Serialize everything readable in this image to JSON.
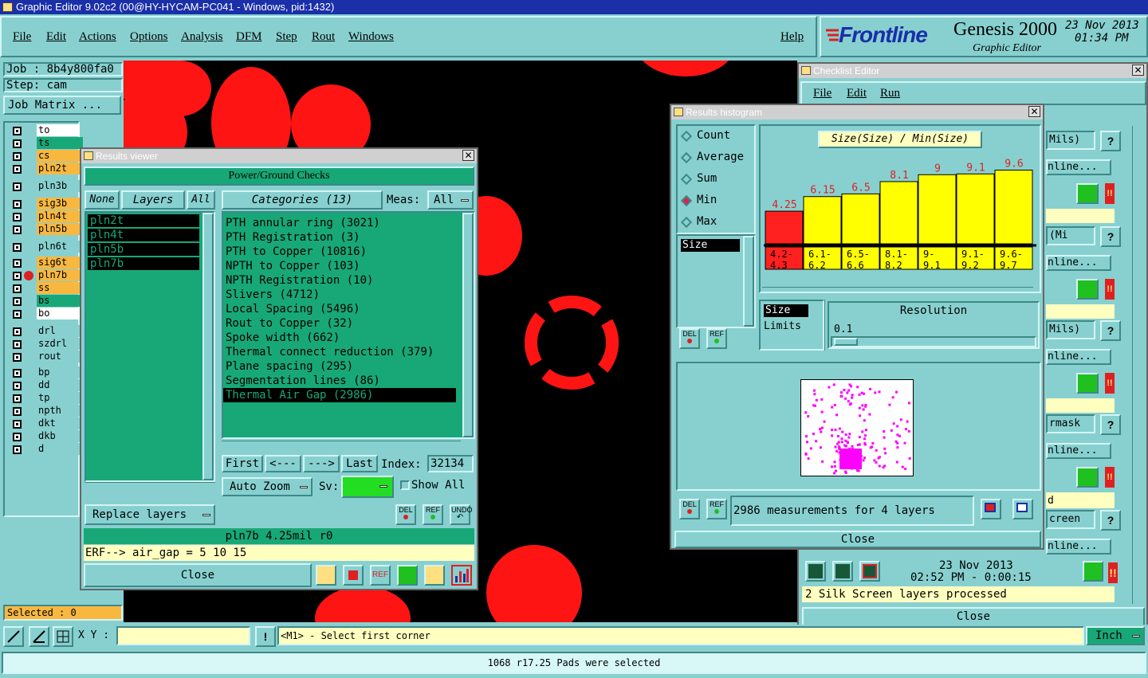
{
  "app": {
    "title": "Graphic Editor 9.02c2 (00@HY-HYCAM-PC041 - Windows, pid:1432)",
    "menu": [
      "File",
      "Edit",
      "Actions",
      "Options",
      "Analysis",
      "DFM",
      "Step",
      "Rout",
      "Windows"
    ],
    "help": "Help",
    "brand_logo": "Frontline",
    "brand_product": "Genesis 2000",
    "brand_sub": "Graphic Editor",
    "date": "23 Nov 2013",
    "time": "01:34 PM"
  },
  "left": {
    "job": "Job : 8b4y800fa0",
    "step": "Step: cam",
    "job_matrix": "Job Matrix ...",
    "layers": [
      {
        "name": "to",
        "color": "#ffffff"
      },
      {
        "name": "ts",
        "color": "#18a878"
      },
      {
        "name": "cs",
        "color": "#f8b840"
      },
      {
        "name": "pln2t",
        "color": "#f8b840"
      },
      {
        "name": "pln3b",
        "color": "#88d0d0"
      },
      {
        "name": "sig3b",
        "color": "#f8b840"
      },
      {
        "name": "pln4t",
        "color": "#f8b840"
      },
      {
        "name": "pln5b",
        "color": "#f8b840"
      },
      {
        "name": "pln6t",
        "color": "#88d0d0"
      },
      {
        "name": "sig6t",
        "color": "#f8b840"
      },
      {
        "name": "pln7b",
        "color": "#f8b840"
      },
      {
        "name": "ss",
        "color": "#f8b840"
      },
      {
        "name": "bs",
        "color": "#18a878"
      },
      {
        "name": "bo",
        "color": "#ffffff"
      },
      {
        "name": "drl",
        "color": "#88d0d0"
      },
      {
        "name": "szdrl",
        "color": "#88d0d0"
      },
      {
        "name": "rout",
        "color": "#88d0d0"
      },
      {
        "name": "bp",
        "color": "#88d0d0"
      },
      {
        "name": "dd",
        "color": "#88d0d0"
      },
      {
        "name": "tp",
        "color": "#88d0d0"
      },
      {
        "name": "npth",
        "color": "#88d0d0"
      },
      {
        "name": "dkt",
        "color": "#88d0d0"
      },
      {
        "name": "dkb",
        "color": "#88d0d0"
      },
      {
        "name": "d",
        "color": "#88d0d0"
      }
    ],
    "selected": "Selected : 0"
  },
  "results_viewer": {
    "title": "Results viewer",
    "header": "Power/Ground Checks",
    "none": "None",
    "layers_label": "Layers",
    "all": "All",
    "categories_label": "Categories (13)",
    "meas_label": "Meas:",
    "meas_value": "All",
    "layers": [
      "pln2t",
      "pln4t",
      "pln5b",
      "pln7b"
    ],
    "categories": [
      "PTH annular ring (3021)",
      "PTH Registration (3)",
      "PTH to Copper (10816)",
      "NPTH to Copper (103)",
      "NPTH Registration (10)",
      "Slivers (4712)",
      "Local Spacing (5496)",
      "Rout to Copper (32)",
      "Spoke width (662)",
      "Thermal connect reduction (379)",
      "Plane spacing (295)",
      "Segmentation lines (86)",
      "Thermal Air Gap (2986)"
    ],
    "first": "First",
    "prev": "<---",
    "next": "--->",
    "last": "Last",
    "index_label": "Index:",
    "index_value": "32134",
    "auto_zoom": "Auto Zoom",
    "sv_label": "Sv:",
    "show_all": "Show All",
    "replace_layers": "Replace layers",
    "del": "DEL",
    "ref": "REF",
    "undo": "UNDO",
    "status": "pln7b 4.25mil  r0",
    "erf": "ERF--> air_gap = 5 10 15",
    "close": "Close"
  },
  "histogram": {
    "title": "Results histogram",
    "modes": [
      "Count",
      "Average",
      "Sum",
      "Min",
      "Max"
    ],
    "selected_mode": "Min",
    "heading": "Size(Size) / Min(Size)",
    "size_list": [
      "Size"
    ],
    "size_label": "Size",
    "limits_label": "Limits",
    "resolution_label": "Resolution",
    "resolution_value": "0.1",
    "del": "DEL",
    "ref": "REF",
    "summary": "2986 measurements for 4 layers",
    "close": "Close"
  },
  "chart_data": {
    "type": "bar",
    "title": "Size(Size) / Min(Size)",
    "categories": [
      "4.2-4.3",
      "6.1-6.2",
      "6.5-6.6",
      "8.1-8.2",
      "9-9.1",
      "9.1-9.2",
      "9.6-9.7"
    ],
    "values": [
      4.25,
      6.15,
      6.5,
      8.1,
      9,
      9.1,
      9.6
    ],
    "labels": [
      "4.25",
      "6.15",
      "6.5",
      "8.1",
      "9",
      "9.1",
      "9.6"
    ],
    "range_top": [
      "4.2-",
      "6.1-",
      "6.5-",
      "8.1-",
      "9-",
      "9.1-",
      "9.6-"
    ],
    "range_bottom": [
      "4.3",
      "6.2",
      "6.6",
      "8.2",
      "9.1",
      "9.2",
      "9.7"
    ],
    "colors": [
      "#ff2020",
      "#ffff00",
      "#ffff00",
      "#ffff00",
      "#ffff00",
      "#ffff00",
      "#ffff00"
    ],
    "ylim": [
      0,
      11
    ]
  },
  "checklist": {
    "title": "Checklist Editor",
    "menu": [
      "File",
      "Edit",
      "Run"
    ],
    "rows": [
      {
        "label": "Mils)",
        "link": "nline..."
      },
      {
        "label": "(Mi",
        "link": "nline..."
      },
      {
        "label": "Mils)",
        "link": "nline..."
      },
      {
        "label": "rmask",
        "link": "nline..."
      },
      {
        "label": "d",
        "link": ""
      },
      {
        "label": "creen",
        "link": "nline..."
      }
    ],
    "date": "23 Nov 2013",
    "time_line": "02:52 PM - 0:00:15",
    "status": "2 Silk Screen layers processed",
    "close": "Close"
  },
  "bottom": {
    "xy_label": "X Y :",
    "xy_value": "",
    "prompt": "<M1> - Select first corner",
    "units": "Inch",
    "status": "1068 r17.25 Pads were selected"
  }
}
